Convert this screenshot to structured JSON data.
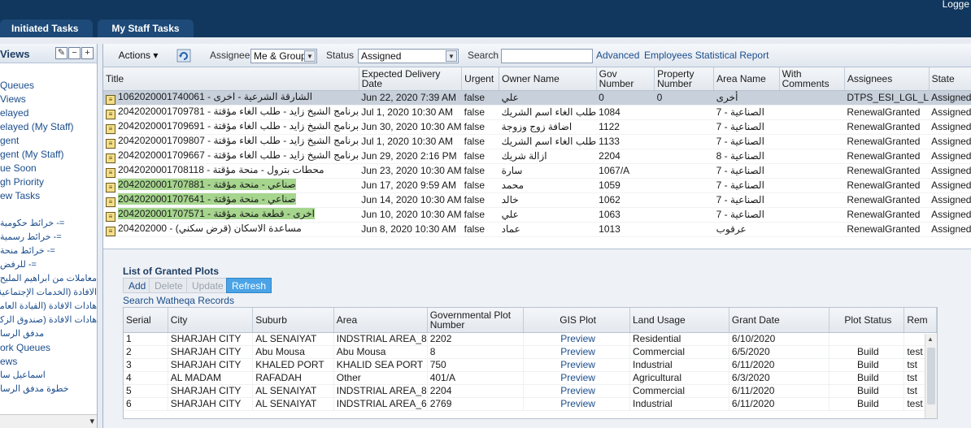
{
  "header": {
    "logged_text": "Logge",
    "tabs": [
      "Initiated Tasks",
      "My Staff Tasks"
    ]
  },
  "sidebar": {
    "title": "Views",
    "edit_icon": "pencil-icon",
    "items": [
      {
        "label": "Queues",
        "rtl": false
      },
      {
        "label": "Views",
        "rtl": false
      },
      {
        "label": "elayed",
        "rtl": false
      },
      {
        "label": "elayed (My Staff)",
        "rtl": false
      },
      {
        "label": "gent",
        "rtl": false
      },
      {
        "label": "gent (My Staff)",
        "rtl": false
      },
      {
        "label": "ue Soon",
        "rtl": false
      },
      {
        "label": "gh Priority",
        "rtl": false
      },
      {
        "label": "ew Tasks",
        "rtl": false
      },
      {
        "label": "",
        "rtl": false
      },
      {
        "label": "=- خرائط حكومية",
        "rtl": true
      },
      {
        "label": "=- خرائط رسمية",
        "rtl": true
      },
      {
        "label": "=- خرائط منحة",
        "rtl": true
      },
      {
        "label": "=- للرفض",
        "rtl": true
      },
      {
        "label": "معاملات من ابراهيم المليح",
        "rtl": true
      },
      {
        "label": "الافادة (الخدمات الإجتماعية",
        "rtl": true
      },
      {
        "label": "هادات الافادة (القيادة العامة",
        "rtl": true
      },
      {
        "label": "هادات الافادة (صندوق الزكاة",
        "rtl": true
      },
      {
        "label": "مدفق الرسا",
        "rtl": true
      },
      {
        "label": "ork Queues",
        "rtl": false
      },
      {
        "label": "ews",
        "rtl": false
      },
      {
        "label": "اسماعيل سا",
        "rtl": true
      },
      {
        "label": "خطوة مدفق الرسا",
        "rtl": true
      }
    ]
  },
  "toolbar": {
    "actions_label": "Actions",
    "assignee_label": "Assignee",
    "assignee_value": "Me & Group",
    "status_label": "Status",
    "status_value": "Assigned",
    "search_label": "Search",
    "search_value": "",
    "advanced_link": "Advanced",
    "report_link": "Employees Statistical Report"
  },
  "tasks": {
    "columns": [
      "Title",
      "Expected Delivery Date",
      "Urgent",
      "Owner Name",
      "Gov Number",
      "Property Number",
      "Area Name",
      "With Comments",
      "Assignees",
      "State"
    ],
    "rows": [
      {
        "title": "1062020001740061 - الشارقة الشرعية - اخرى",
        "title_hl": false,
        "date": "Jun 22, 2020 7:39 AM",
        "urgent": "false",
        "owner": "علي",
        "gov": "0",
        "prop": "0",
        "area": "أخرى",
        "comments": "",
        "assignees": "DTPS_ESI_LGL_L",
        "state": "Assigned",
        "selected": true
      },
      {
        "title": "2042020001709781 - برنامج الشيخ زايد - طلب الغاء مؤقتة",
        "title_hl": false,
        "date": "Jul 1, 2020 10:30 AM",
        "urgent": "false",
        "owner": "طلب الغاء اسم الشريك",
        "gov": "1084",
        "prop": "",
        "area": "الصناعية - 7",
        "comments": "",
        "assignees": "RenewalGranted",
        "state": "Assigned",
        "selected": false
      },
      {
        "title": "2042020001709691 - برنامج الشيخ زايد - طلب الغاء مؤقتة",
        "title_hl": false,
        "date": "Jun 30, 2020 10:30 AM",
        "urgent": "false",
        "owner": "اضافة زوج وزوجة",
        "gov": "1122",
        "prop": "",
        "area": "الصناعية - 7",
        "comments": "",
        "assignees": "RenewalGranted",
        "state": "Assigned",
        "selected": false
      },
      {
        "title": "2042020001709807 - برنامج الشيخ زايد - طلب الغاء مؤقتة",
        "title_hl": false,
        "date": "Jul 1, 2020 10:30 AM",
        "urgent": "false",
        "owner": "طلب الغاء اسم الشريك",
        "gov": "1133",
        "prop": "",
        "area": "الصناعية - 7",
        "comments": "",
        "assignees": "RenewalGranted",
        "state": "Assigned",
        "selected": false
      },
      {
        "title": "2042020001709667 - برنامج الشيخ زايد - طلب الغاء مؤقتة",
        "title_hl": false,
        "date": "Jun 29, 2020 2:16 PM",
        "urgent": "false",
        "owner": "ازالة شريك",
        "gov": "2204",
        "prop": "",
        "area": "الصناعية - 8",
        "comments": "",
        "assignees": "RenewalGranted",
        "state": "Assigned",
        "selected": false
      },
      {
        "title": "2042020001708118 - محطات بترول - منحة مؤقتة",
        "title_hl": false,
        "date": "Jun 23, 2020 10:30 AM",
        "urgent": "false",
        "owner": "سارة",
        "gov": "1067/A",
        "prop": "",
        "area": "الصناعية - 7",
        "comments": "",
        "assignees": "RenewalGranted",
        "state": "Assigned",
        "selected": false
      },
      {
        "title": "2042020001707881 - صناعي - منحة مؤقتة",
        "title_hl": true,
        "date": "Jun 17, 2020 9:59 AM",
        "urgent": "false",
        "owner": "محمد",
        "gov": "1059",
        "prop": "",
        "area": "الصناعية - 7",
        "comments": "",
        "assignees": "RenewalGranted",
        "state": "Assigned",
        "selected": false
      },
      {
        "title": "2042020001707641 - صناعي - منحة مؤقتة",
        "title_hl": true,
        "date": "Jun 14, 2020 10:30 AM",
        "urgent": "false",
        "owner": "خالد",
        "gov": "1062",
        "prop": "",
        "area": "الصناعية - 7",
        "comments": "",
        "assignees": "RenewalGranted",
        "state": "Assigned",
        "selected": false
      },
      {
        "title": "2042020001707571 - اخرى - قطعة منحة مؤقتة",
        "title_hl": true,
        "date": "Jun 10, 2020 10:30 AM",
        "urgent": "false",
        "owner": "علي",
        "gov": "1063",
        "prop": "",
        "area": "الصناعية - 7",
        "comments": "",
        "assignees": "RenewalGranted",
        "state": "Assigned",
        "selected": false
      },
      {
        "title": "204202000 - مساعدة الاسكان (قرض سكني)",
        "title_hl": false,
        "date": "Jun 8, 2020 10:30 AM",
        "urgent": "false",
        "owner": "عماد",
        "gov": "1013",
        "prop": "",
        "area": "عرقوب",
        "comments": "",
        "assignees": "RenewalGranted",
        "state": "Assigned",
        "selected": false
      }
    ]
  },
  "plots": {
    "title": "List of Granted Plots",
    "buttons": {
      "add": "Add",
      "delete": "Delete",
      "update": "Update",
      "refresh": "Refresh"
    },
    "search_link": "Search Watheqa Records",
    "columns": [
      "Serial",
      "City",
      "Suburb",
      "Area",
      "Governmental Plot Number",
      "GIS Plot",
      "Land Usage",
      "Grant Date",
      "Plot Status",
      "Rem"
    ],
    "rows": [
      {
        "serial": "1",
        "city": "SHARJAH CITY",
        "suburb": "AL SENAIYAT",
        "area": "INDSTRIAL AREA_8",
        "gov": "2202",
        "gis": "Preview",
        "usage": "Residential",
        "date": "6/10/2020",
        "status": "",
        "rem": ""
      },
      {
        "serial": "2",
        "city": "SHARJAH CITY",
        "suburb": "Abu Mousa",
        "area": "Abu Mousa",
        "gov": "8",
        "gis": "Preview",
        "usage": "Commercial",
        "date": "6/5/2020",
        "status": "Build",
        "rem": "test"
      },
      {
        "serial": "3",
        "city": "SHARJAH CITY",
        "suburb": "KHALED PORT",
        "area": "KHALID SEA PORT",
        "gov": "750",
        "gis": "Preview",
        "usage": "Industrial",
        "date": "6/11/2020",
        "status": "Build",
        "rem": "tst"
      },
      {
        "serial": "4",
        "city": "AL MADAM",
        "suburb": "RAFADAH",
        "area": "Other",
        "gov": "401/A",
        "gis": "Preview",
        "usage": "Agricultural",
        "date": "6/3/2020",
        "status": "Build",
        "rem": "tst"
      },
      {
        "serial": "5",
        "city": "SHARJAH CITY",
        "suburb": "AL SENAIYAT",
        "area": "INDSTRIAL AREA_8",
        "gov": "2204",
        "gis": "Preview",
        "usage": "Commercial",
        "date": "6/11/2020",
        "status": "Build",
        "rem": "tst"
      },
      {
        "serial": "6",
        "city": "SHARJAH CITY",
        "suburb": "AL SENAIYAT",
        "area": "INDSTRIAL AREA_6",
        "gov": "2769",
        "gis": "Preview",
        "usage": "Industrial",
        "date": "6/11/2020",
        "status": "Build",
        "rem": "test"
      }
    ]
  }
}
